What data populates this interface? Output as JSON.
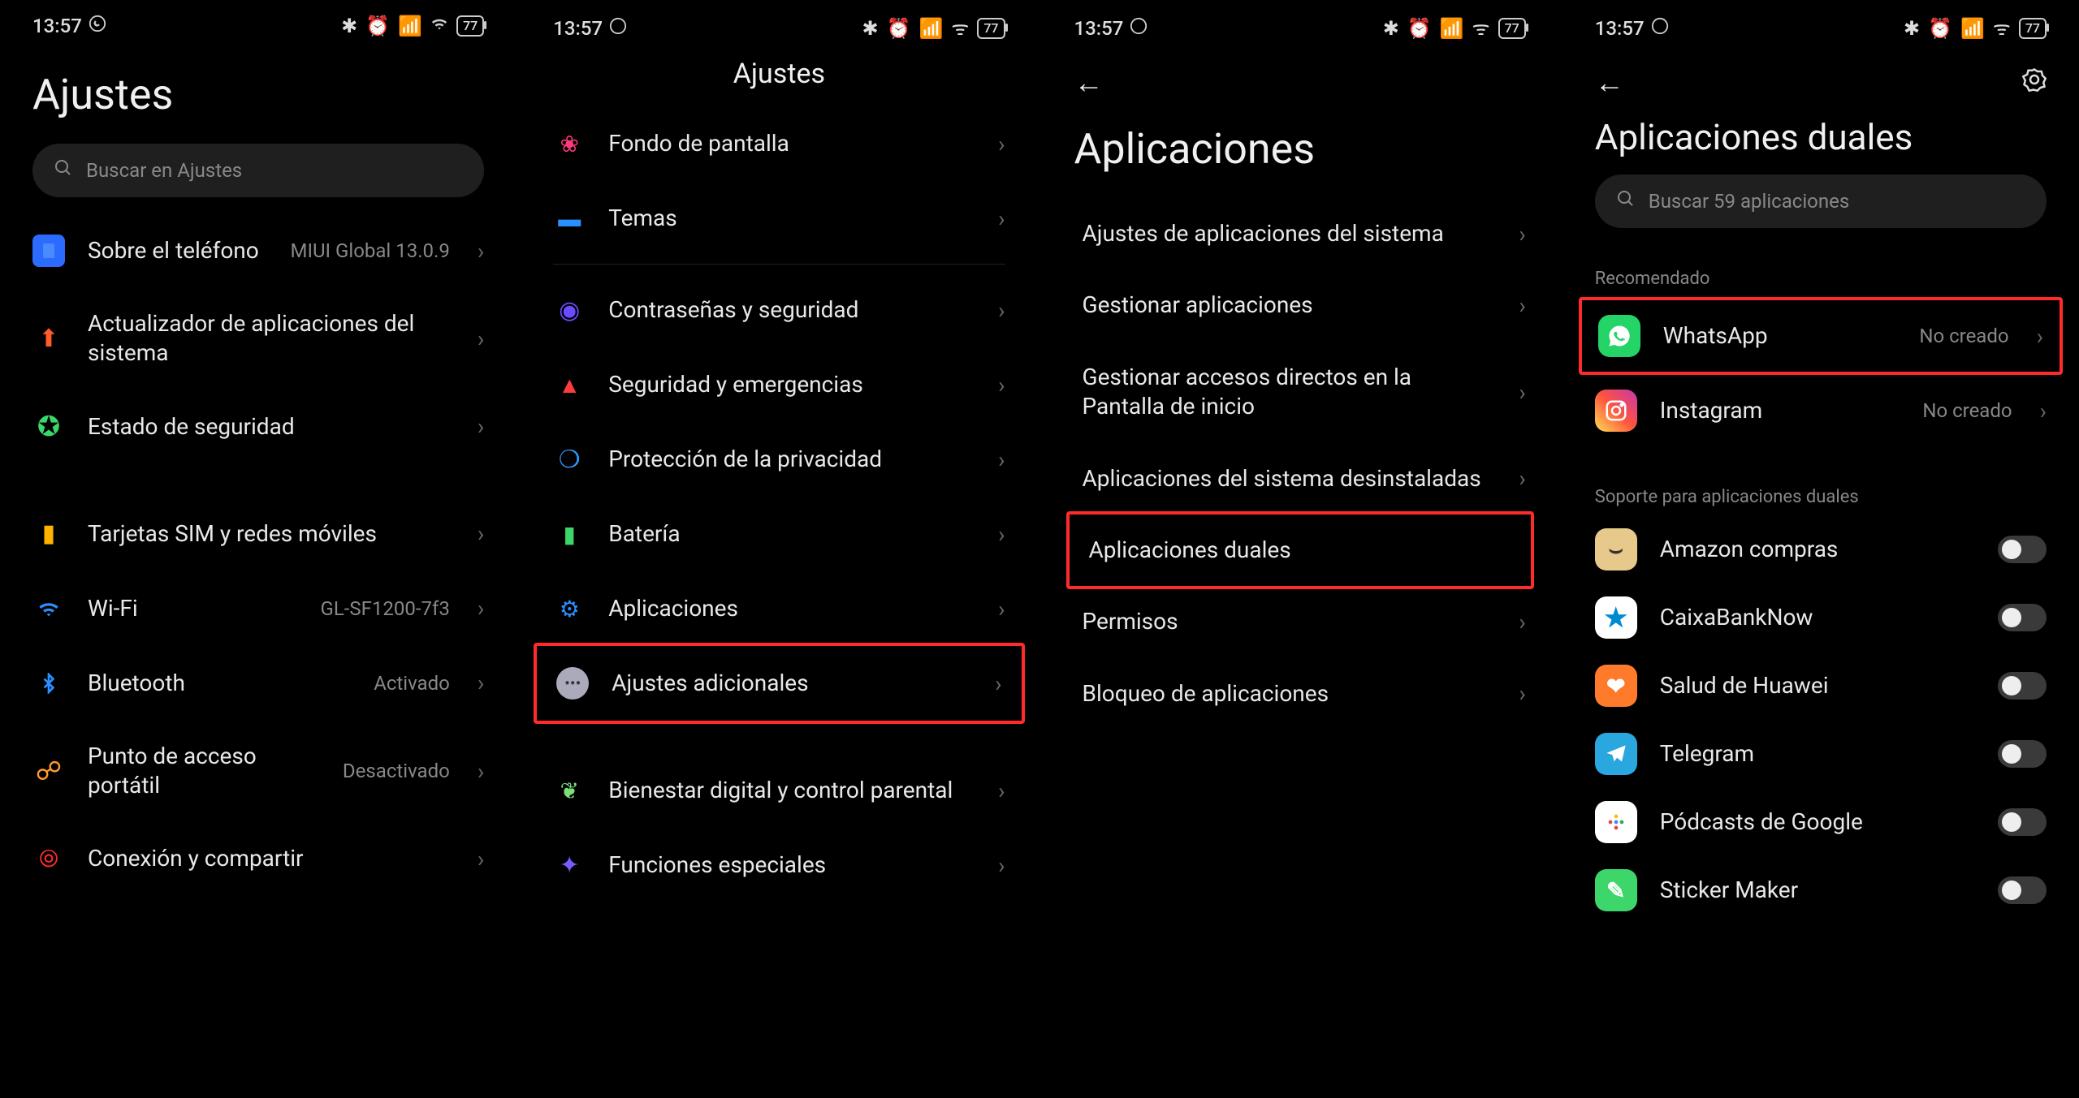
{
  "status": {
    "time": "13:57",
    "battery": "77"
  },
  "screen1": {
    "title": "Ajustes",
    "search_placeholder": "Buscar en Ajustes",
    "rows": [
      {
        "label": "Sobre el teléfono",
        "value": "MIUI Global 13.0.9"
      },
      {
        "label": "Actualizador de aplicaciones del sistema"
      },
      {
        "label": "Estado de seguridad"
      },
      {
        "label": "Tarjetas SIM y redes móviles"
      },
      {
        "label": "Wi-Fi",
        "value": "GL-SF1200-7f3"
      },
      {
        "label": "Bluetooth",
        "value": "Activado"
      },
      {
        "label": "Punto de acceso portátil",
        "value": "Desactivado"
      },
      {
        "label": "Conexión y compartir"
      }
    ]
  },
  "screen2": {
    "title": "Ajustes",
    "rows": [
      {
        "label": "Fondo de pantalla"
      },
      {
        "label": "Temas"
      },
      {
        "label": "Contraseñas y seguridad"
      },
      {
        "label": "Seguridad y emergencias"
      },
      {
        "label": "Protección de la privacidad"
      },
      {
        "label": "Batería"
      },
      {
        "label": "Aplicaciones"
      },
      {
        "label": "Ajustes adicionales"
      },
      {
        "label": "Bienestar digital y control parental"
      },
      {
        "label": "Funciones especiales"
      }
    ]
  },
  "screen3": {
    "title": "Aplicaciones",
    "rows": [
      {
        "label": "Ajustes de aplicaciones del sistema"
      },
      {
        "label": "Gestionar aplicaciones"
      },
      {
        "label": "Gestionar accesos directos en la Pantalla de inicio"
      },
      {
        "label": "Aplicaciones del sistema desinstaladas"
      },
      {
        "label": "Aplicaciones duales"
      },
      {
        "label": "Permisos"
      },
      {
        "label": "Bloqueo de aplicaciones"
      }
    ]
  },
  "screen4": {
    "title": "Aplicaciones duales",
    "search_placeholder": "Buscar 59 aplicaciones",
    "group_recommended": "Recomendado",
    "group_supported": "Soporte para aplicaciones duales",
    "recommended": [
      {
        "label": "WhatsApp",
        "value": "No creado"
      },
      {
        "label": "Instagram",
        "value": "No creado"
      }
    ],
    "supported": [
      {
        "label": "Amazon compras"
      },
      {
        "label": "CaixaBankNow"
      },
      {
        "label": "Salud de Huawei"
      },
      {
        "label": "Telegram"
      },
      {
        "label": "Pódcasts de Google"
      },
      {
        "label": "Sticker Maker"
      }
    ]
  }
}
